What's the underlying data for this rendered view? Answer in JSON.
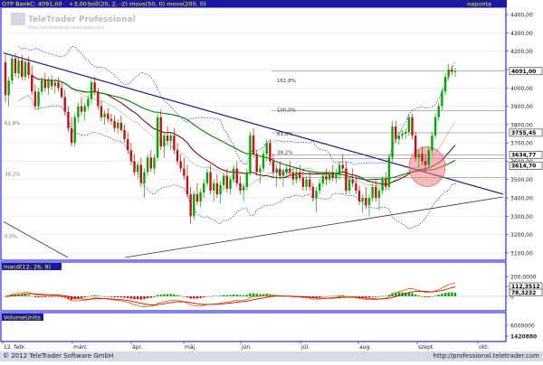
{
  "header": {
    "symbol": "OTP Bank",
    "quote": "C: 4091,00",
    "change": "+3,00",
    "indicators": "boll(20, 2, -2) movs(50, 0) movs(200, 0)",
    "period": "naponta"
  },
  "watermark": {
    "brand": "TeleTrader Professional",
    "url": "http://professional.teletrader.com"
  },
  "footer": {
    "copyright": "© 2012 TeleTrader Software GmbH",
    "url": "http://professional.teletrader.com"
  },
  "colors": {
    "background": "#ffffff",
    "price_frame": "#0000ff",
    "header_bar": "#1a1aa0",
    "header_text": "#ffff00",
    "up_candle": "#00a800",
    "down_candle": "#c81010",
    "ma50": "#7a1010",
    "ma200": "#008000",
    "bollinger": "#0000cc",
    "trend_line": "#1a1a8c",
    "ellipse_fill": "#f08080",
    "macd_line": "#e07000",
    "signal_line": "#c81010"
  },
  "chart_data": [
    {
      "type": "candlestick",
      "panel": "price",
      "y_axis_labels": [
        "4400,00",
        "4300,00",
        "4200,00",
        "4100,00",
        "4000,00",
        "3900,00",
        "3800,00",
        "3700,00",
        "3600,00",
        "3500,00",
        "3400,00",
        "3300,00",
        "3200,00",
        "3100,00"
      ],
      "ylim": [
        3070,
        4430
      ],
      "highlighted_labels": [
        "4091,00",
        "3755,45",
        "3634,77",
        "3614,70"
      ],
      "fibonacci_labels": [
        "161,8%",
        "100,0%",
        "61,8%",
        "38,2%",
        "0,0%"
      ],
      "left_fib_labels": [
        "61,8%",
        "38,2%",
        "0,0%"
      ],
      "x_labels": [
        "12. febr.",
        "márc.",
        "ápr.",
        "máj.",
        "jún.",
        "júl.",
        "aug.",
        "szept.",
        "okt."
      ],
      "candles": [
        {
          "o": 4140,
          "h": 4180,
          "l": 3920,
          "c": 3960
        },
        {
          "o": 3960,
          "h": 4060,
          "l": 3900,
          "c": 4040
        },
        {
          "o": 4040,
          "h": 4180,
          "l": 4020,
          "c": 4160
        },
        {
          "o": 4160,
          "h": 4190,
          "l": 4060,
          "c": 4080
        },
        {
          "o": 4080,
          "h": 4170,
          "l": 4050,
          "c": 4150
        },
        {
          "o": 4150,
          "h": 4180,
          "l": 4040,
          "c": 4060
        },
        {
          "o": 4060,
          "h": 4160,
          "l": 4040,
          "c": 4140
        },
        {
          "o": 4140,
          "h": 4170,
          "l": 4050,
          "c": 4070
        },
        {
          "o": 4070,
          "h": 4120,
          "l": 3960,
          "c": 3980
        },
        {
          "o": 3980,
          "h": 4020,
          "l": 3880,
          "c": 3900
        },
        {
          "o": 3900,
          "h": 4000,
          "l": 3880,
          "c": 3980
        },
        {
          "o": 3980,
          "h": 4060,
          "l": 3960,
          "c": 4040
        },
        {
          "o": 4040,
          "h": 4080,
          "l": 3980,
          "c": 4000
        },
        {
          "o": 4000,
          "h": 4060,
          "l": 3960,
          "c": 4040
        },
        {
          "o": 4040,
          "h": 4070,
          "l": 3990,
          "c": 4010
        },
        {
          "o": 4010,
          "h": 4050,
          "l": 3970,
          "c": 4030
        },
        {
          "o": 4030,
          "h": 4060,
          "l": 3980,
          "c": 4000
        },
        {
          "o": 4000,
          "h": 4030,
          "l": 3940,
          "c": 3950
        },
        {
          "o": 3950,
          "h": 3990,
          "l": 3850,
          "c": 3870
        },
        {
          "o": 3870,
          "h": 3900,
          "l": 3760,
          "c": 3780
        },
        {
          "o": 3780,
          "h": 3840,
          "l": 3680,
          "c": 3700
        },
        {
          "o": 3700,
          "h": 3860,
          "l": 3680,
          "c": 3840
        },
        {
          "o": 3840,
          "h": 3920,
          "l": 3810,
          "c": 3900
        },
        {
          "o": 3900,
          "h": 3950,
          "l": 3850,
          "c": 3870
        },
        {
          "o": 3870,
          "h": 3920,
          "l": 3820,
          "c": 3900
        },
        {
          "o": 3900,
          "h": 3960,
          "l": 3880,
          "c": 3940
        },
        {
          "o": 3940,
          "h": 4050,
          "l": 3910,
          "c": 4030
        },
        {
          "o": 4030,
          "h": 4060,
          "l": 3960,
          "c": 3980
        },
        {
          "o": 3980,
          "h": 4000,
          "l": 3880,
          "c": 3900
        },
        {
          "o": 3900,
          "h": 3930,
          "l": 3820,
          "c": 3840
        },
        {
          "o": 3840,
          "h": 3880,
          "l": 3800,
          "c": 3860
        },
        {
          "o": 3860,
          "h": 3890,
          "l": 3810,
          "c": 3830
        },
        {
          "o": 3830,
          "h": 3860,
          "l": 3800,
          "c": 3820
        },
        {
          "o": 3820,
          "h": 3850,
          "l": 3760,
          "c": 3780
        },
        {
          "o": 3780,
          "h": 3830,
          "l": 3750,
          "c": 3810
        },
        {
          "o": 3810,
          "h": 3850,
          "l": 3760,
          "c": 3770
        },
        {
          "o": 3770,
          "h": 3800,
          "l": 3700,
          "c": 3720
        },
        {
          "o": 3720,
          "h": 3760,
          "l": 3640,
          "c": 3660
        },
        {
          "o": 3660,
          "h": 3700,
          "l": 3580,
          "c": 3600
        },
        {
          "o": 3600,
          "h": 3640,
          "l": 3520,
          "c": 3540
        },
        {
          "o": 3540,
          "h": 3600,
          "l": 3500,
          "c": 3580
        },
        {
          "o": 3580,
          "h": 3620,
          "l": 3460,
          "c": 3480
        },
        {
          "o": 3480,
          "h": 3560,
          "l": 3400,
          "c": 3540
        },
        {
          "o": 3540,
          "h": 3640,
          "l": 3520,
          "c": 3620
        },
        {
          "o": 3620,
          "h": 3660,
          "l": 3540,
          "c": 3560
        },
        {
          "o": 3560,
          "h": 3640,
          "l": 3530,
          "c": 3620
        },
        {
          "o": 3620,
          "h": 3860,
          "l": 3600,
          "c": 3840
        },
        {
          "o": 3840,
          "h": 3880,
          "l": 3660,
          "c": 3680
        },
        {
          "o": 3680,
          "h": 3760,
          "l": 3620,
          "c": 3740
        },
        {
          "o": 3740,
          "h": 3790,
          "l": 3690,
          "c": 3710
        },
        {
          "o": 3710,
          "h": 3760,
          "l": 3660,
          "c": 3740
        },
        {
          "o": 3740,
          "h": 3780,
          "l": 3640,
          "c": 3660
        },
        {
          "o": 3660,
          "h": 3700,
          "l": 3580,
          "c": 3600
        },
        {
          "o": 3600,
          "h": 3640,
          "l": 3540,
          "c": 3560
        },
        {
          "o": 3560,
          "h": 3620,
          "l": 3500,
          "c": 3520
        },
        {
          "o": 3520,
          "h": 3580,
          "l": 3400,
          "c": 3420
        },
        {
          "o": 3420,
          "h": 3460,
          "l": 3260,
          "c": 3300
        },
        {
          "o": 3300,
          "h": 3440,
          "l": 3280,
          "c": 3420
        },
        {
          "o": 3420,
          "h": 3480,
          "l": 3360,
          "c": 3380
        },
        {
          "o": 3380,
          "h": 3450,
          "l": 3350,
          "c": 3430
        },
        {
          "o": 3430,
          "h": 3500,
          "l": 3400,
          "c": 3480
        },
        {
          "o": 3480,
          "h": 3560,
          "l": 3460,
          "c": 3540
        },
        {
          "o": 3540,
          "h": 3580,
          "l": 3420,
          "c": 3440
        },
        {
          "o": 3440,
          "h": 3500,
          "l": 3380,
          "c": 3480
        },
        {
          "o": 3480,
          "h": 3530,
          "l": 3400,
          "c": 3420
        },
        {
          "o": 3420,
          "h": 3490,
          "l": 3370,
          "c": 3470
        },
        {
          "o": 3470,
          "h": 3540,
          "l": 3440,
          "c": 3520
        },
        {
          "o": 3520,
          "h": 3560,
          "l": 3430,
          "c": 3450
        },
        {
          "o": 3450,
          "h": 3520,
          "l": 3420,
          "c": 3500
        },
        {
          "o": 3500,
          "h": 3580,
          "l": 3480,
          "c": 3560
        },
        {
          "o": 3560,
          "h": 3600,
          "l": 3460,
          "c": 3480
        },
        {
          "o": 3480,
          "h": 3520,
          "l": 3420,
          "c": 3440
        },
        {
          "o": 3440,
          "h": 3480,
          "l": 3380,
          "c": 3460
        },
        {
          "o": 3460,
          "h": 3560,
          "l": 3440,
          "c": 3540
        },
        {
          "o": 3540,
          "h": 3760,
          "l": 3520,
          "c": 3740
        },
        {
          "o": 3740,
          "h": 3780,
          "l": 3620,
          "c": 3640
        },
        {
          "o": 3640,
          "h": 3660,
          "l": 3520,
          "c": 3540
        },
        {
          "o": 3540,
          "h": 3580,
          "l": 3480,
          "c": 3560
        },
        {
          "o": 3560,
          "h": 3660,
          "l": 3540,
          "c": 3640
        },
        {
          "o": 3640,
          "h": 3720,
          "l": 3600,
          "c": 3700
        },
        {
          "o": 3700,
          "h": 3720,
          "l": 3580,
          "c": 3600
        },
        {
          "o": 3600,
          "h": 3640,
          "l": 3520,
          "c": 3540
        },
        {
          "o": 3540,
          "h": 3580,
          "l": 3460,
          "c": 3560
        },
        {
          "o": 3560,
          "h": 3600,
          "l": 3500,
          "c": 3520
        },
        {
          "o": 3520,
          "h": 3560,
          "l": 3460,
          "c": 3540
        },
        {
          "o": 3540,
          "h": 3580,
          "l": 3520,
          "c": 3560
        },
        {
          "o": 3560,
          "h": 3600,
          "l": 3520,
          "c": 3540
        },
        {
          "o": 3540,
          "h": 3560,
          "l": 3470,
          "c": 3500
        },
        {
          "o": 3500,
          "h": 3560,
          "l": 3480,
          "c": 3540
        },
        {
          "o": 3540,
          "h": 3580,
          "l": 3490,
          "c": 3510
        },
        {
          "o": 3510,
          "h": 3560,
          "l": 3440,
          "c": 3460
        },
        {
          "o": 3460,
          "h": 3520,
          "l": 3440,
          "c": 3500
        },
        {
          "o": 3500,
          "h": 3540,
          "l": 3440,
          "c": 3460
        },
        {
          "o": 3460,
          "h": 3480,
          "l": 3380,
          "c": 3400
        },
        {
          "o": 3400,
          "h": 3460,
          "l": 3320,
          "c": 3440
        },
        {
          "o": 3440,
          "h": 3500,
          "l": 3420,
          "c": 3480
        },
        {
          "o": 3480,
          "h": 3540,
          "l": 3460,
          "c": 3520
        },
        {
          "o": 3520,
          "h": 3560,
          "l": 3470,
          "c": 3500
        },
        {
          "o": 3500,
          "h": 3550,
          "l": 3480,
          "c": 3540
        },
        {
          "o": 3540,
          "h": 3580,
          "l": 3490,
          "c": 3510
        },
        {
          "o": 3510,
          "h": 3560,
          "l": 3480,
          "c": 3530
        },
        {
          "o": 3530,
          "h": 3600,
          "l": 3500,
          "c": 3580
        },
        {
          "o": 3580,
          "h": 3640,
          "l": 3540,
          "c": 3560
        },
        {
          "o": 3560,
          "h": 3600,
          "l": 3420,
          "c": 3440
        },
        {
          "o": 3440,
          "h": 3520,
          "l": 3420,
          "c": 3500
        },
        {
          "o": 3500,
          "h": 3560,
          "l": 3460,
          "c": 3480
        },
        {
          "o": 3480,
          "h": 3520,
          "l": 3420,
          "c": 3440
        },
        {
          "o": 3440,
          "h": 3470,
          "l": 3360,
          "c": 3380
        },
        {
          "o": 3380,
          "h": 3420,
          "l": 3320,
          "c": 3400
        },
        {
          "o": 3400,
          "h": 3460,
          "l": 3340,
          "c": 3360
        },
        {
          "o": 3360,
          "h": 3420,
          "l": 3300,
          "c": 3400
        },
        {
          "o": 3400,
          "h": 3480,
          "l": 3380,
          "c": 3460
        },
        {
          "o": 3460,
          "h": 3510,
          "l": 3380,
          "c": 3400
        },
        {
          "o": 3400,
          "h": 3460,
          "l": 3330,
          "c": 3440
        },
        {
          "o": 3440,
          "h": 3520,
          "l": 3420,
          "c": 3500
        },
        {
          "o": 3500,
          "h": 3540,
          "l": 3440,
          "c": 3460
        },
        {
          "o": 3460,
          "h": 3640,
          "l": 3440,
          "c": 3620
        },
        {
          "o": 3620,
          "h": 3820,
          "l": 3600,
          "c": 3790
        },
        {
          "o": 3790,
          "h": 3820,
          "l": 3700,
          "c": 3720
        },
        {
          "o": 3720,
          "h": 3760,
          "l": 3690,
          "c": 3740
        },
        {
          "o": 3740,
          "h": 3770,
          "l": 3720,
          "c": 3750
        },
        {
          "o": 3750,
          "h": 3780,
          "l": 3720,
          "c": 3760
        },
        {
          "o": 3760,
          "h": 3860,
          "l": 3740,
          "c": 3840
        },
        {
          "o": 3840,
          "h": 3860,
          "l": 3720,
          "c": 3740
        },
        {
          "o": 3740,
          "h": 3760,
          "l": 3600,
          "c": 3620
        },
        {
          "o": 3620,
          "h": 3660,
          "l": 3560,
          "c": 3640
        },
        {
          "o": 3640,
          "h": 3680,
          "l": 3580,
          "c": 3600
        },
        {
          "o": 3600,
          "h": 3640,
          "l": 3540,
          "c": 3580
        },
        {
          "o": 3580,
          "h": 3680,
          "l": 3560,
          "c": 3660
        },
        {
          "o": 3660,
          "h": 3760,
          "l": 3640,
          "c": 3740
        },
        {
          "o": 3740,
          "h": 3860,
          "l": 3720,
          "c": 3840
        },
        {
          "o": 3840,
          "h": 3920,
          "l": 3820,
          "c": 3900
        },
        {
          "o": 3900,
          "h": 4000,
          "l": 3880,
          "c": 3980
        },
        {
          "o": 3980,
          "h": 4080,
          "l": 3960,
          "c": 4060
        },
        {
          "o": 4060,
          "h": 4130,
          "l": 4040,
          "c": 4100
        },
        {
          "o": 4100,
          "h": 4120,
          "l": 4070,
          "c": 4088
        },
        {
          "o": 4088,
          "h": 4110,
          "l": 4060,
          "c": 4091
        }
      ]
    },
    {
      "type": "macd",
      "title": "macd(12, 26, 9)",
      "y_axis_labels": [
        "200,0000",
        "100,0000",
        "0"
      ],
      "highlighted_labels": [
        "112,3512",
        "78,3232"
      ]
    },
    {
      "type": "volume",
      "title": "VolumeUnits",
      "y_axis_labels": [
        "6000000",
        "1420880"
      ]
    }
  ]
}
